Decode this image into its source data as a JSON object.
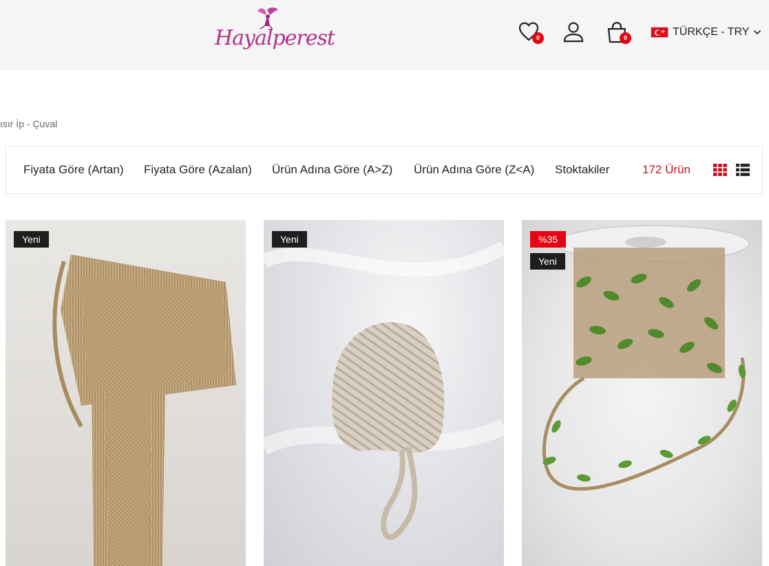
{
  "header": {
    "logo_text": "Hayalperest",
    "wishlist_count": "0",
    "cart_count": "0",
    "language": "TÜRKÇE - TRY"
  },
  "breadcrumb": "ısır İp - Çuval",
  "sort": {
    "options": [
      "Fiyata Göre (Artan)",
      "Fiyata Göre (Azalan)",
      "Ürün Adına Göre (A>Z)",
      "Ürün Adına Göre (Z<A)",
      "Stoktakiler"
    ],
    "count": "172 Ürün"
  },
  "products": [
    {
      "badges": [
        "Yeni"
      ]
    },
    {
      "badges": [
        "Yeni"
      ]
    },
    {
      "badges": [
        "%35",
        "Yeni"
      ]
    }
  ],
  "colors": {
    "accent": "#e30613",
    "logo": "#b2308c",
    "count": "#c1121f"
  }
}
